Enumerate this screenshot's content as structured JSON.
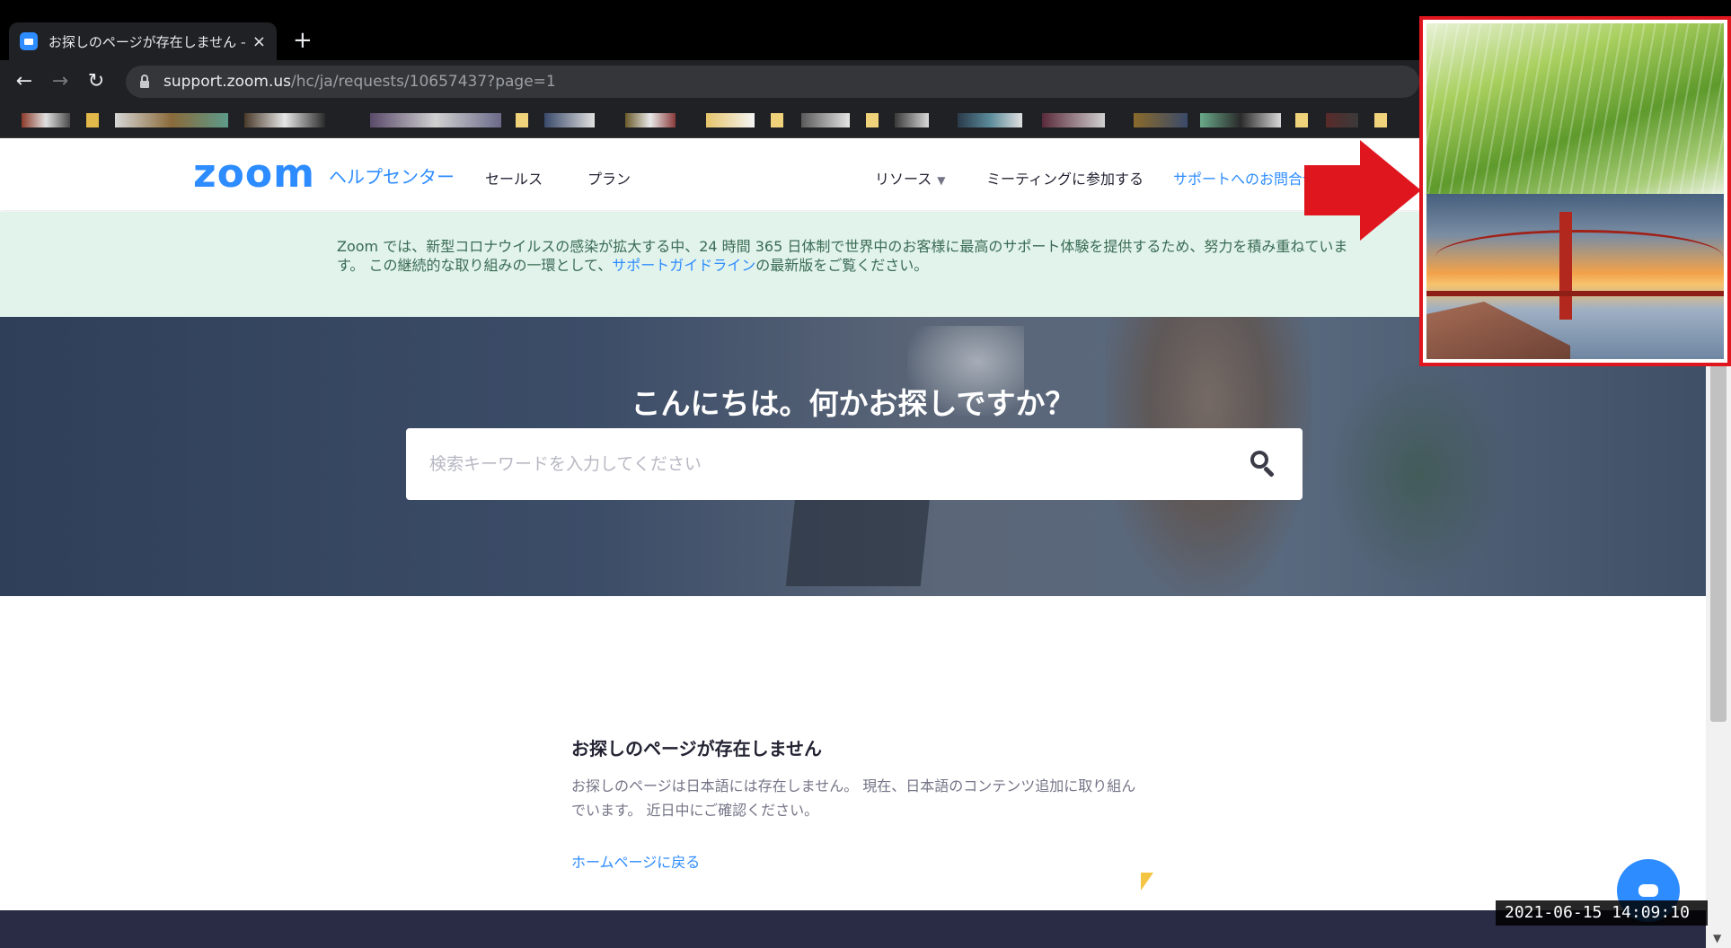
{
  "browser": {
    "tab_title": "お探しのページが存在しません – Zoom",
    "tab_close": "×",
    "new_tab": "+",
    "url_host": "support.zoom.us",
    "url_path": "/hc/ja/requests/10657437?page=1"
  },
  "header": {
    "logo": "zoom",
    "help_center": "ヘルプセンター",
    "nav": {
      "sales": "セールス",
      "plans": "プラン",
      "resources": "リソース",
      "join_meeting": "ミーティングに参加する",
      "contact_support": "サポートへのお問合せ"
    }
  },
  "notice": {
    "text_before": "Zoom では、新型コロナウイルスの感染が拡大する中、24 時間 365 日体制で世界中のお客様に最高のサポート体験を提供するため、努力を積み重ねています。 この継続的な取り組みの一環として、",
    "link": "サポートガイドライン",
    "text_after": "の最新版をご覧ください。"
  },
  "hero": {
    "title": "こんにちは。何かお探しですか？",
    "search_placeholder": "検索キーワードを入力してください"
  },
  "not_found": {
    "title": "お探しのページが存在しません",
    "body": "お探しのページは日本語には存在しません。 現在、日本語のコンテンツ追加に取り組んでいます。 近日中にご確認ください。",
    "home_link": "ホームページに戻る"
  },
  "overlay": {
    "timestamp": "2021-06-15  14:09:10",
    "wallpapers": [
      "grass-wallpaper",
      "golden-gate-bridge-wallpaper"
    ]
  },
  "colors": {
    "zoom_blue": "#2d8cff",
    "notice_bg": "#e1f3ea",
    "highlight_red": "#e0161f",
    "footer_bg": "#2a2c45"
  }
}
